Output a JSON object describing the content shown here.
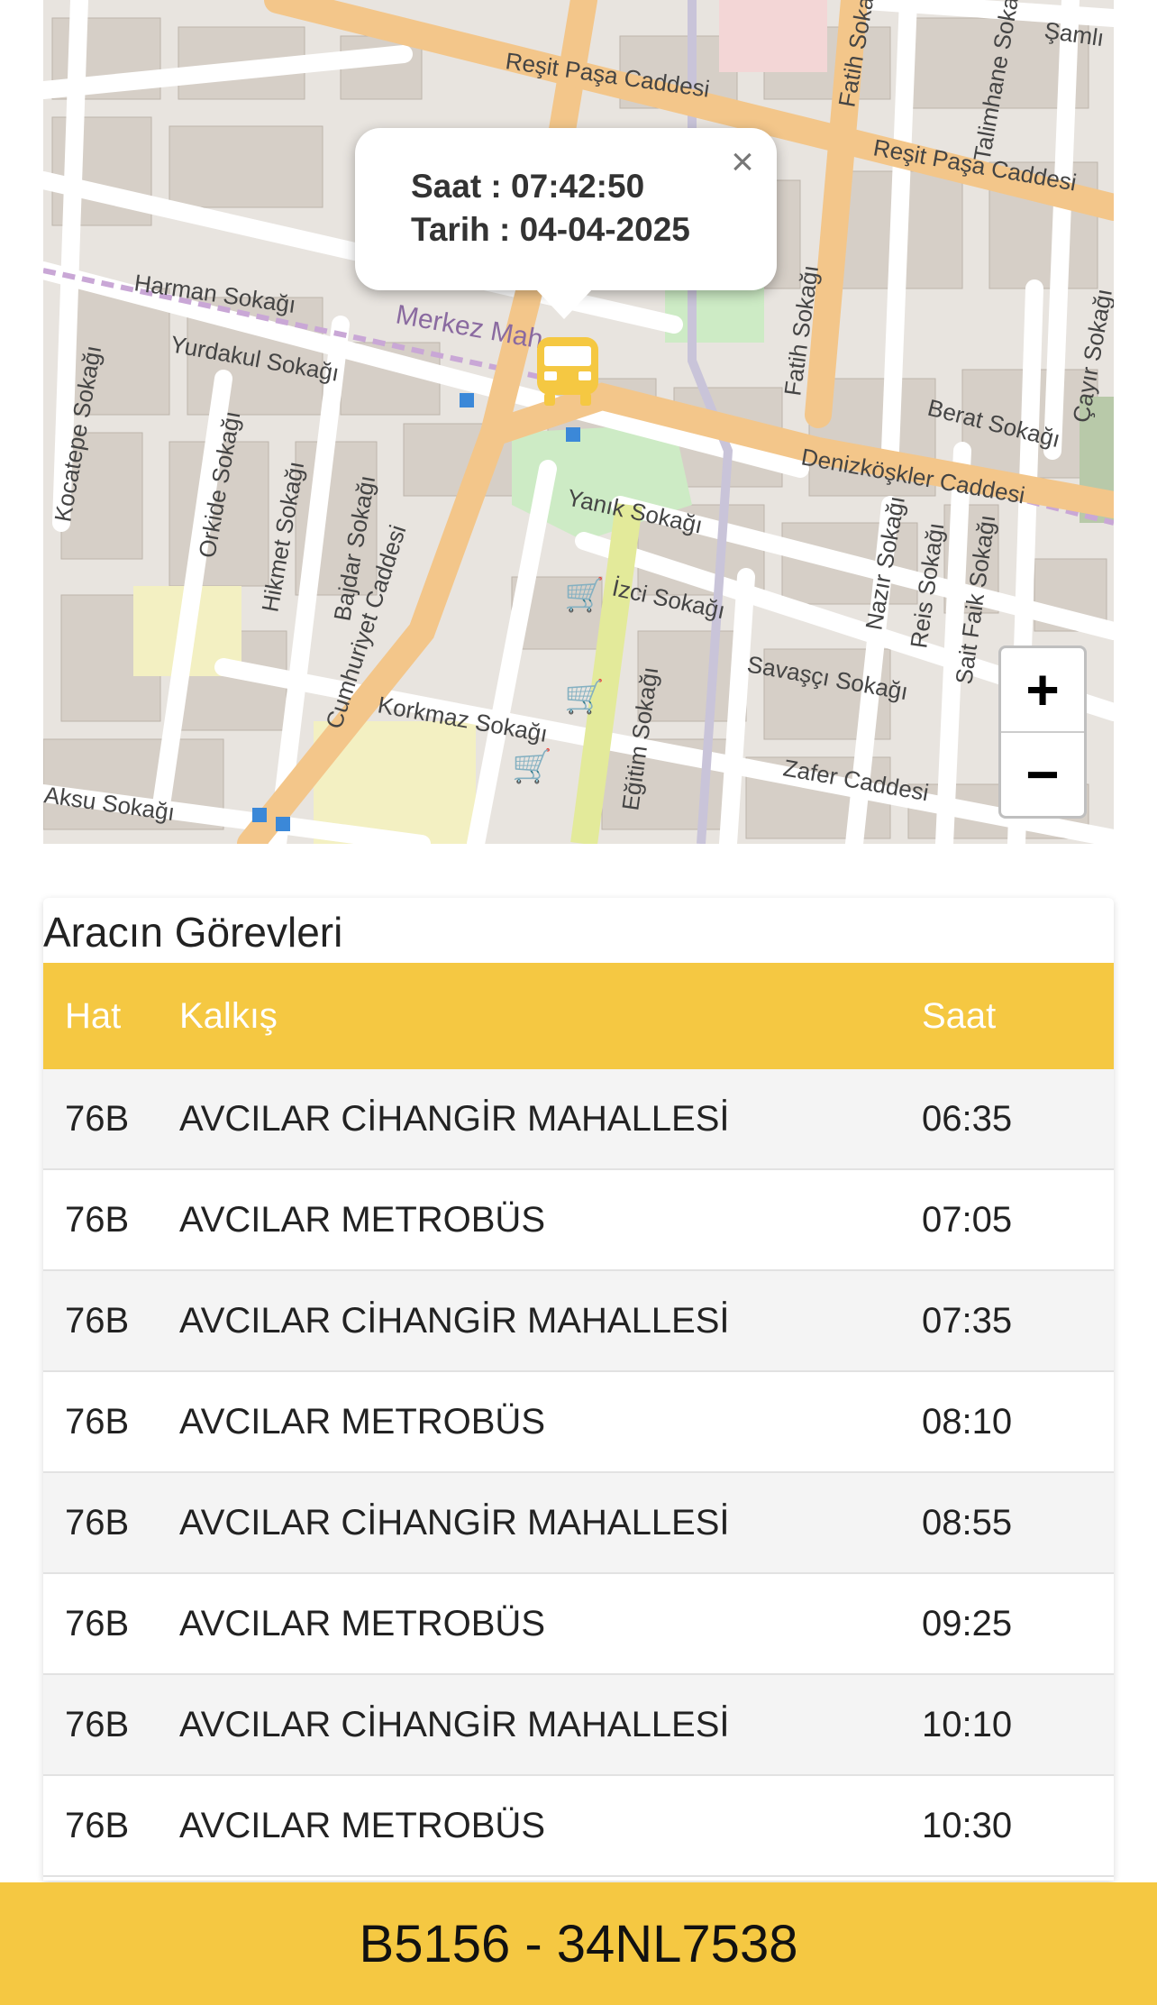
{
  "map": {
    "popup": {
      "time_label": "Saat : 07:42:50",
      "date_label": "Tarih : 04-04-2025"
    },
    "zoom": {
      "in": "+",
      "out": "−"
    },
    "streets": [
      "Reşit Paşa Caddesi",
      "Reşit Paşa Caddesi",
      "Fatih Sokağı",
      "Fatih Sokağı",
      "Harman Sokağı",
      "Yurdakul Sokağı",
      "Merkez Mah.",
      "Berat Sokağı",
      "Denizköşkler Caddesi",
      "Yanık Sokağı",
      "İzci Sokağı",
      "Kocatepe Sokağı",
      "Orkide Sokağı",
      "Hikmet Sokağı",
      "Bajdar Sokağı",
      "Cumhuriyet Caddesi",
      "Korkmaz Sokağı",
      "Eğitim Sokağı",
      "Savaşçı Sokağı",
      "Nazır Sokağı",
      "Reis Sokağı",
      "Sait Faik Sokağı",
      "Zafer Caddesi",
      "Aksu Sokağı",
      "Talimhane Sokağı",
      "Şamlı",
      "Çayır Sokağı"
    ],
    "colors": {
      "main_road": "#f3c68a",
      "park": "#cdebc5",
      "building": "#d6cfc7",
      "bus": "#f5c842",
      "stop": "#3b88d8"
    }
  },
  "tasks": {
    "title": "Aracın Görevleri",
    "columns": [
      "Hat",
      "Kalkış",
      "Saat"
    ],
    "rows": [
      [
        "76B",
        "AVCILAR CİHANGİR MAHALLESİ",
        "06:35"
      ],
      [
        "76B",
        "AVCILAR METROBÜS",
        "07:05"
      ],
      [
        "76B",
        "AVCILAR CİHANGİR MAHALLESİ",
        "07:35"
      ],
      [
        "76B",
        "AVCILAR METROBÜS",
        "08:10"
      ],
      [
        "76B",
        "AVCILAR CİHANGİR MAHALLESİ",
        "08:55"
      ],
      [
        "76B",
        "AVCILAR METROBÜS",
        "09:25"
      ],
      [
        "76B",
        "AVCILAR CİHANGİR MAHALLESİ",
        "10:10"
      ],
      [
        "76B",
        "AVCILAR METROBÜS",
        "10:30"
      ]
    ]
  },
  "footer": {
    "vehicle": "B5156 - 34NL7538"
  }
}
